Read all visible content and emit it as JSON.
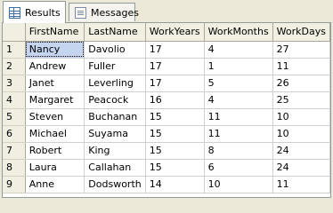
{
  "tabs": [
    {
      "label": "Results",
      "icon": "results-grid-icon",
      "active": true
    },
    {
      "label": "Messages",
      "icon": "messages-icon",
      "active": false
    }
  ],
  "grid": {
    "columns": [
      "FirstName",
      "LastName",
      "WorkYears",
      "WorkMonths",
      "WorkDays"
    ],
    "rows": [
      {
        "num": "1",
        "cells": [
          "Nancy",
          "Davolio",
          "17",
          "4",
          "27"
        ]
      },
      {
        "num": "2",
        "cells": [
          "Andrew",
          "Fuller",
          "17",
          "1",
          "11"
        ]
      },
      {
        "num": "3",
        "cells": [
          "Janet",
          "Leverling",
          "17",
          "5",
          "26"
        ]
      },
      {
        "num": "4",
        "cells": [
          "Margaret",
          "Peacock",
          "16",
          "4",
          "25"
        ]
      },
      {
        "num": "5",
        "cells": [
          "Steven",
          "Buchanan",
          "15",
          "11",
          "10"
        ]
      },
      {
        "num": "6",
        "cells": [
          "Michael",
          "Suyama",
          "15",
          "11",
          "10"
        ]
      },
      {
        "num": "7",
        "cells": [
          "Robert",
          "King",
          "15",
          "8",
          "24"
        ]
      },
      {
        "num": "8",
        "cells": [
          "Laura",
          "Callahan",
          "15",
          "6",
          "24"
        ]
      },
      {
        "num": "9",
        "cells": [
          "Anne",
          "Dodsworth",
          "14",
          "10",
          "11"
        ]
      }
    ],
    "selected_cell": "Nancy"
  }
}
